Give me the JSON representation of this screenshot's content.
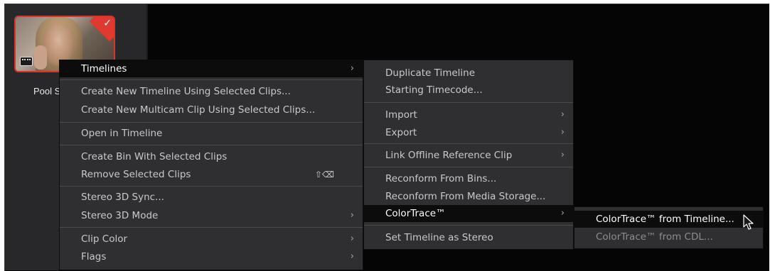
{
  "clip": {
    "label": "Pool S"
  },
  "menu_main": {
    "items": [
      {
        "label": "Timelines",
        "arrow": "›"
      },
      {
        "label": "Create New Timeline Using Selected Clips..."
      },
      {
        "label": "Create New Multicam Clip Using Selected Clips..."
      },
      {
        "label": "Open in Timeline"
      },
      {
        "label": "Create Bin With Selected Clips"
      },
      {
        "label": "Remove Selected Clips",
        "shortcut": "⇧⌫"
      },
      {
        "label": "Stereo 3D Sync..."
      },
      {
        "label": "Stereo 3D Mode",
        "arrow": "›"
      },
      {
        "label": "Clip Color",
        "arrow": "›"
      },
      {
        "label": "Flags",
        "arrow": "›"
      }
    ]
  },
  "menu_timelines": {
    "items": [
      {
        "label": "Duplicate Timeline"
      },
      {
        "label": "Starting Timecode..."
      },
      {
        "label": "Import",
        "arrow": "›"
      },
      {
        "label": "Export",
        "arrow": "›"
      },
      {
        "label": "Link Offline Reference Clip",
        "arrow": "›"
      },
      {
        "label": "Reconform From Bins..."
      },
      {
        "label": "Reconform From Media Storage..."
      },
      {
        "label": "ColorTrace™",
        "arrow": "›"
      },
      {
        "label": "Set Timeline as Stereo"
      }
    ]
  },
  "menu_colortrace": {
    "items": [
      {
        "label": "ColorTrace™ from Timeline..."
      },
      {
        "label": "ColorTrace™ from CDL..."
      }
    ]
  },
  "colors": {
    "accent_red": "#d9342b",
    "menu_bg": "#2f2f32",
    "highlight_bg": "#0c0c0d"
  }
}
